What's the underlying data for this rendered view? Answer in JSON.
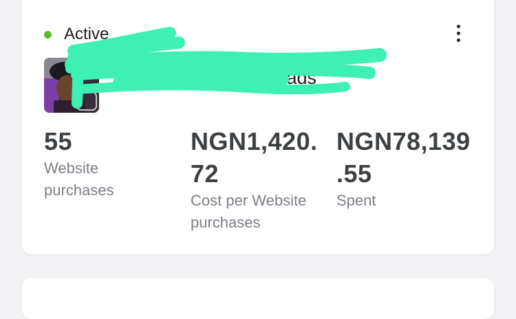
{
  "status": {
    "label": "Active",
    "dot_color": "#5cb831"
  },
  "menu": {
    "icon": "more-vertical-icon"
  },
  "ad": {
    "name": "Kmax ads",
    "thumbnail": "ad-thumbnail-photo",
    "redaction_color": "#3ff0b4"
  },
  "metrics": [
    {
      "value_line1": "55",
      "value_line2": "",
      "label_line1": "Website",
      "label_line2": "purchases"
    },
    {
      "value_line1": "NGN1,420.",
      "value_line2": "72",
      "label_line1": "Cost per Website",
      "label_line2": "purchases"
    },
    {
      "value_line1": "NGN78,139",
      "value_line2": ".55",
      "label_line1": "Spent",
      "label_line2": ""
    }
  ]
}
